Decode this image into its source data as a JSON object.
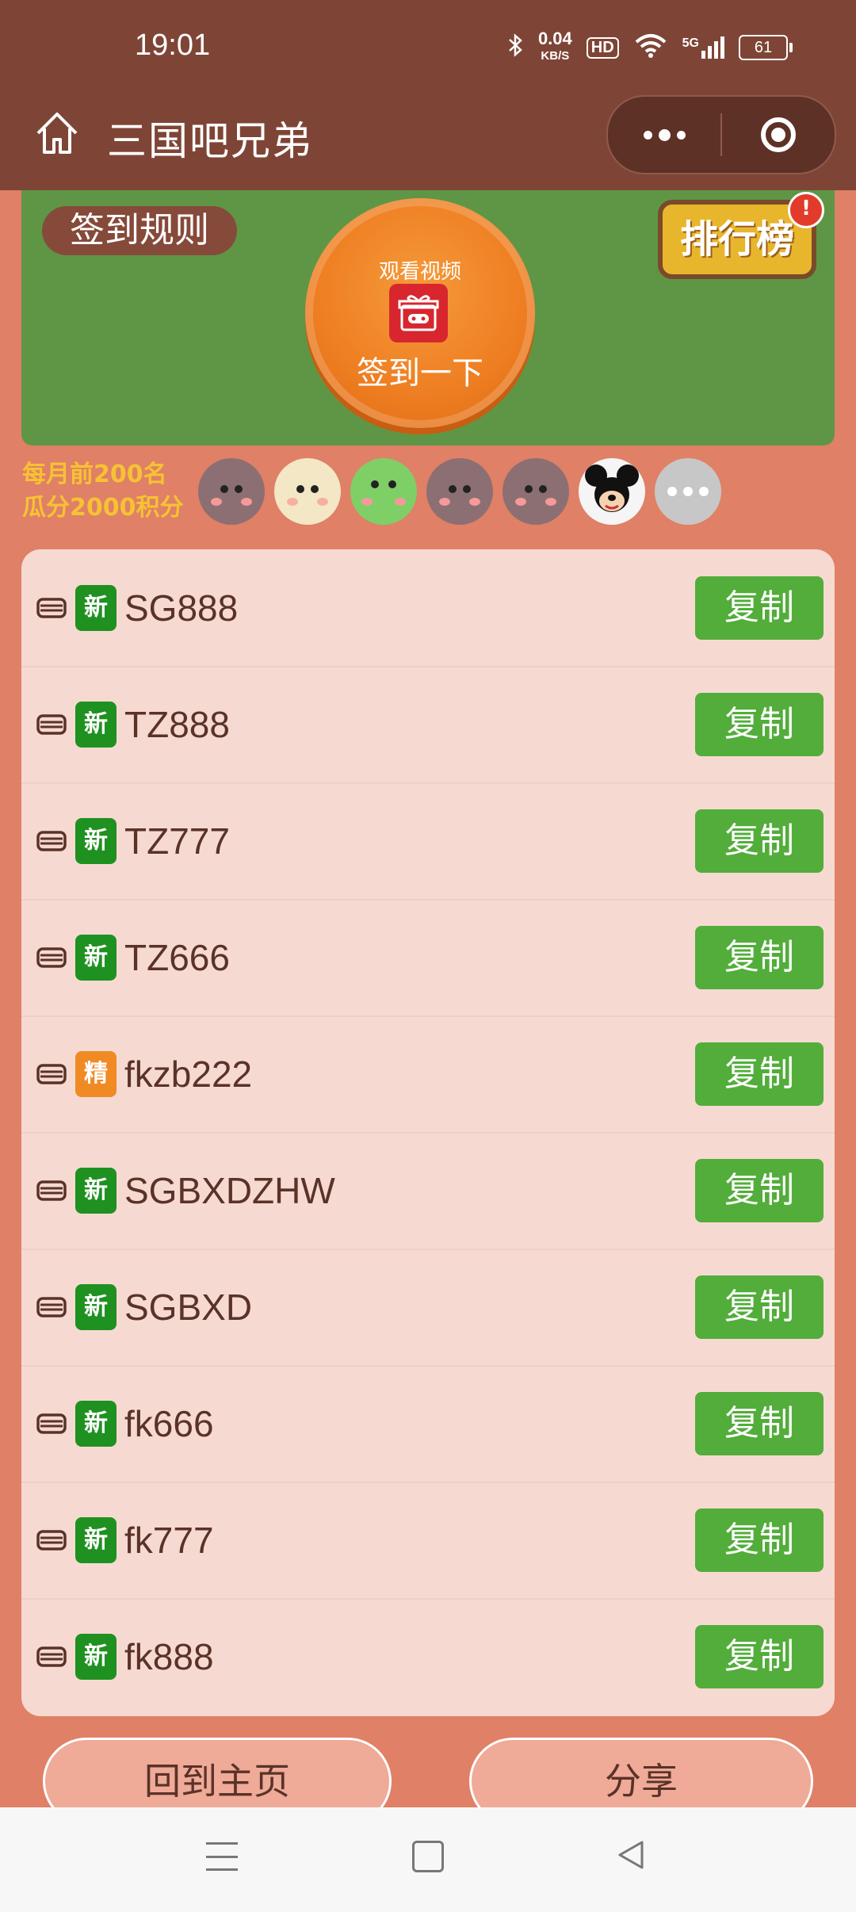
{
  "status_bar": {
    "time": "19:01",
    "net_speed_value": "0.04",
    "net_speed_unit": "KB/S",
    "hd": "HD",
    "signal_label": "5G",
    "battery": "61"
  },
  "header": {
    "title": "三国吧兄弟"
  },
  "banner": {
    "rules_label": "签到规则",
    "checkin_sub": "观看视频",
    "checkin_label": "签到一下",
    "rank_label": "排行榜",
    "rank_badge": "!"
  },
  "promo": {
    "line1": "每月前200名",
    "line2": "瓜分2000积分"
  },
  "avatars": [
    "bear-avatar",
    "bear-cream-avatar",
    "frog-avatar",
    "bear-avatar",
    "bear-avatar",
    "mouse-avatar",
    "more-avatar"
  ],
  "codes": [
    {
      "tag": "新",
      "tag_type": "new",
      "code": "SG888",
      "action": "复制"
    },
    {
      "tag": "新",
      "tag_type": "new",
      "code": "TZ888",
      "action": "复制"
    },
    {
      "tag": "新",
      "tag_type": "new",
      "code": "TZ777",
      "action": "复制"
    },
    {
      "tag": "新",
      "tag_type": "new",
      "code": "TZ666",
      "action": "复制"
    },
    {
      "tag": "精",
      "tag_type": "fine",
      "code": "fkzb222",
      "action": "复制"
    },
    {
      "tag": "新",
      "tag_type": "new",
      "code": "SGBXDZHW",
      "action": "复制"
    },
    {
      "tag": "新",
      "tag_type": "new",
      "code": "SGBXD",
      "action": "复制"
    },
    {
      "tag": "新",
      "tag_type": "new",
      "code": "fk666",
      "action": "复制"
    },
    {
      "tag": "新",
      "tag_type": "new",
      "code": "fk777",
      "action": "复制"
    },
    {
      "tag": "新",
      "tag_type": "new",
      "code": "fk888",
      "action": "复制"
    }
  ],
  "footer": {
    "home_label": "回到主页",
    "share_label": "分享"
  },
  "colors": {
    "header_bg": "#7e4536",
    "page_bg": "#e08066",
    "banner_bg": "#5f9645",
    "copy_button": "#52ad3a",
    "tag_new": "#1f9121",
    "tag_fine": "#f08a24"
  }
}
